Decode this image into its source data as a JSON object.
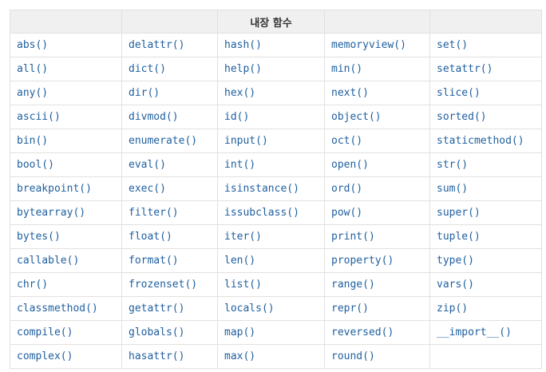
{
  "header": [
    "",
    "",
    "내장 함수",
    "",
    ""
  ],
  "columns": [
    [
      "abs()",
      "all()",
      "any()",
      "ascii()",
      "bin()",
      "bool()",
      "breakpoint()",
      "bytearray()",
      "bytes()",
      "callable()",
      "chr()",
      "classmethod()",
      "compile()",
      "complex()"
    ],
    [
      "delattr()",
      "dict()",
      "dir()",
      "divmod()",
      "enumerate()",
      "eval()",
      "exec()",
      "filter()",
      "float()",
      "format()",
      "frozenset()",
      "getattr()",
      "globals()",
      "hasattr()"
    ],
    [
      "hash()",
      "help()",
      "hex()",
      "id()",
      "input()",
      "int()",
      "isinstance()",
      "issubclass()",
      "iter()",
      "len()",
      "list()",
      "locals()",
      "map()",
      "max()"
    ],
    [
      "memoryview()",
      "min()",
      "next()",
      "object()",
      "oct()",
      "open()",
      "ord()",
      "pow()",
      "print()",
      "property()",
      "range()",
      "repr()",
      "reversed()",
      "round()"
    ],
    [
      "set()",
      "setattr()",
      "slice()",
      "sorted()",
      "staticmethod()",
      "str()",
      "sum()",
      "super()",
      "tuple()",
      "type()",
      "vars()",
      "zip()",
      "__import__()",
      ""
    ]
  ]
}
